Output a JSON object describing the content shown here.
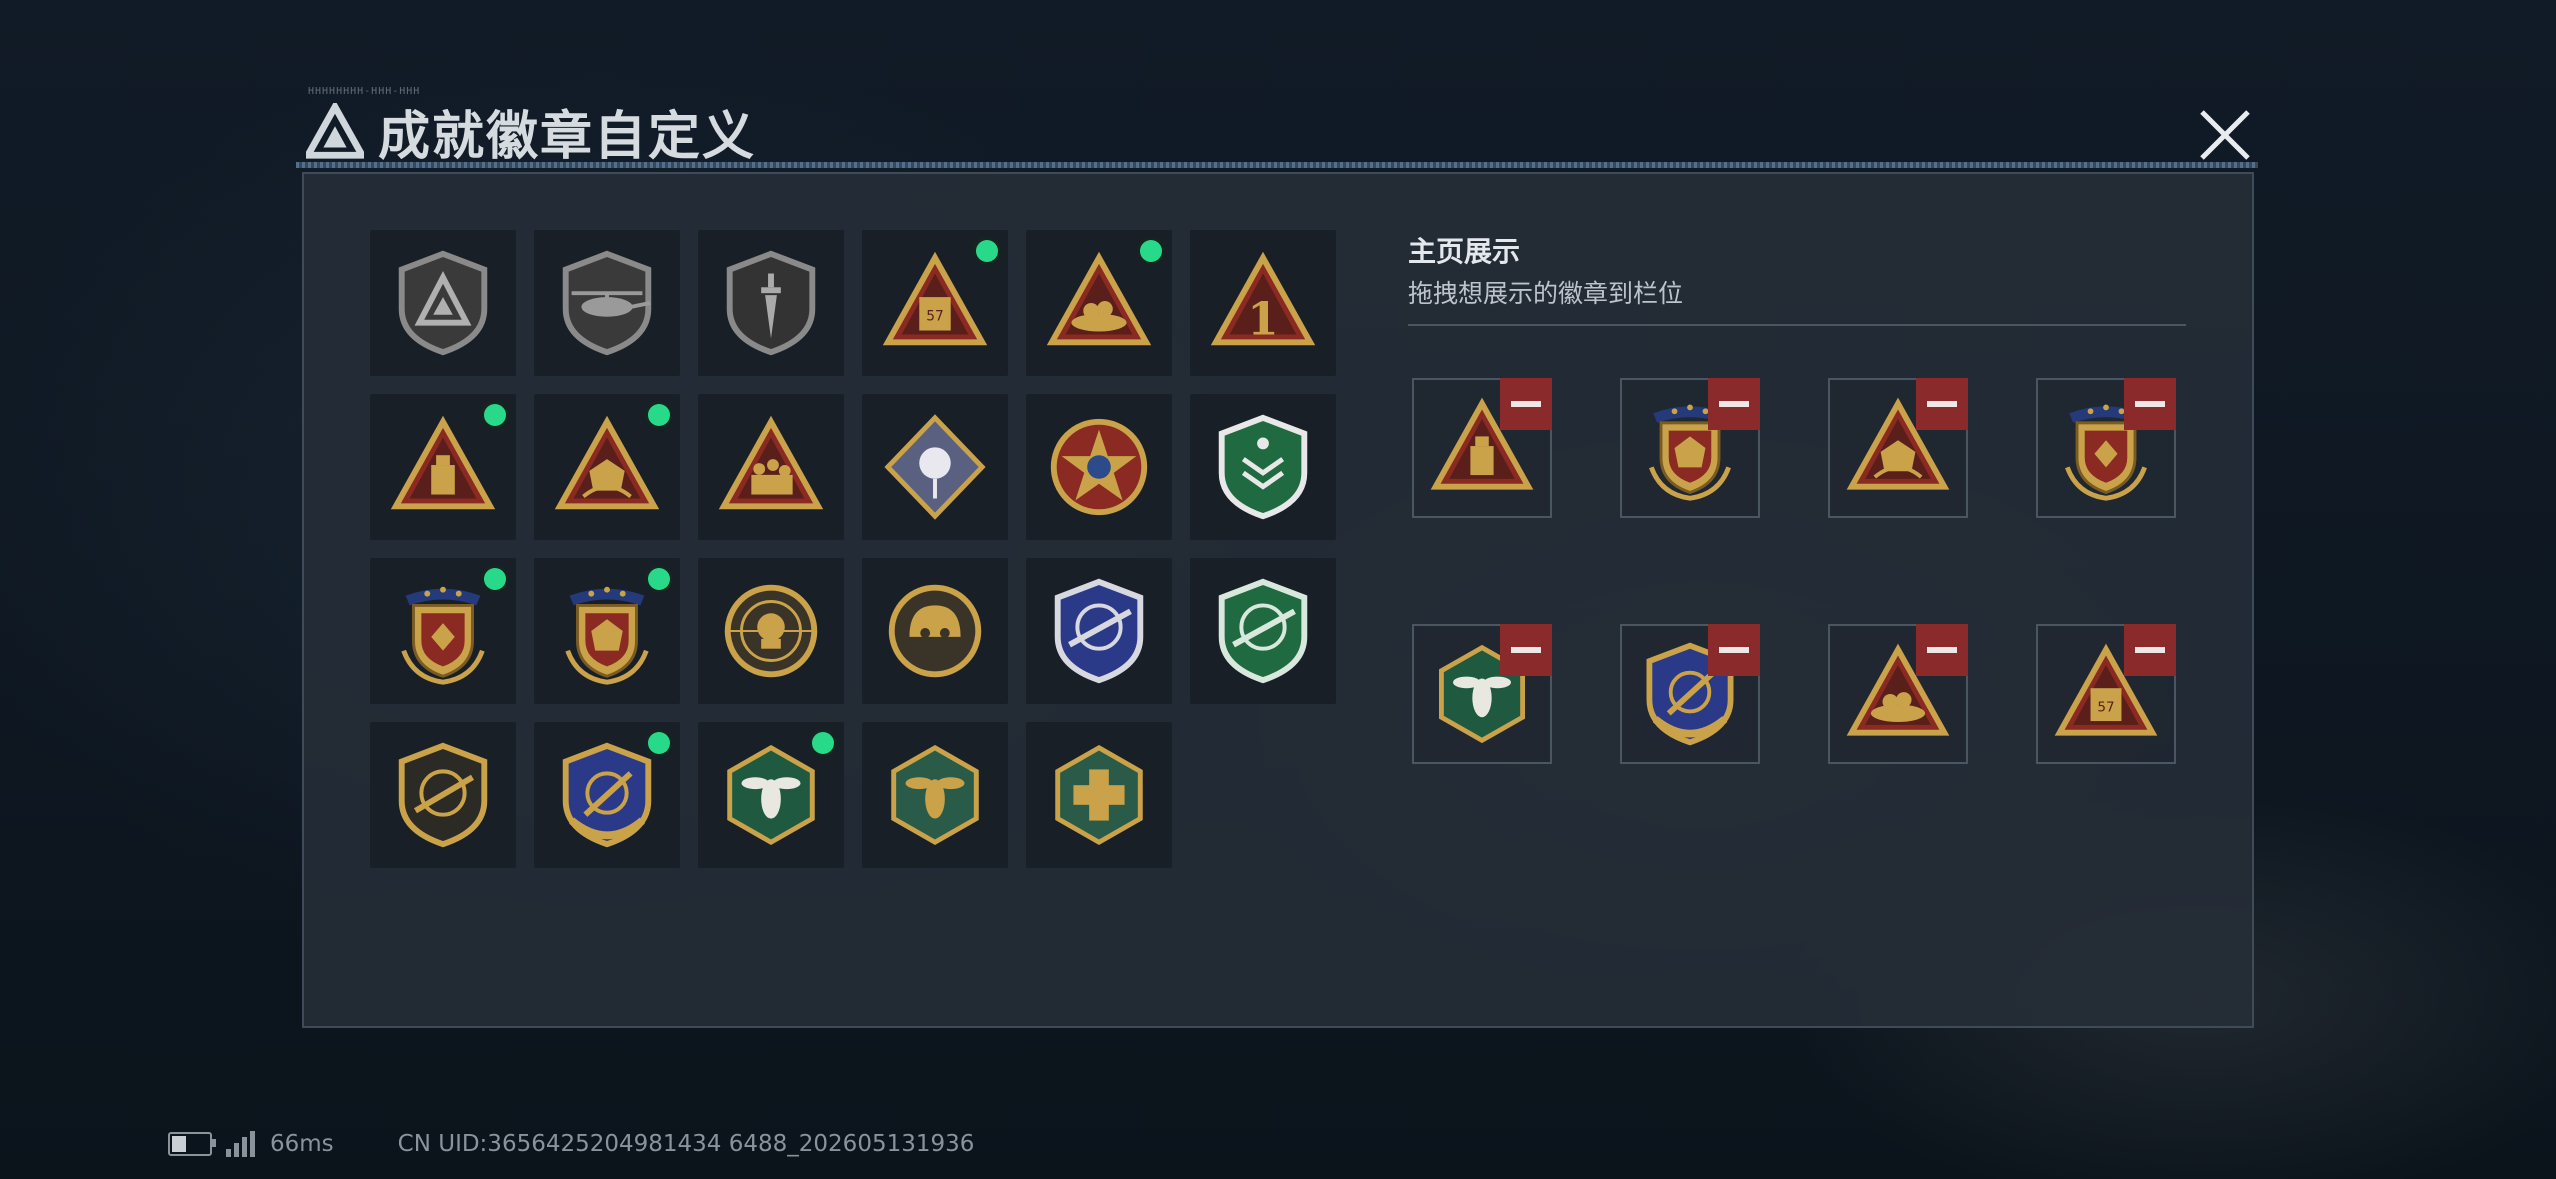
{
  "header": {
    "title": "成就徽章自定义",
    "micro_text": "HHHHHHHH-HHH-HHH"
  },
  "showcase": {
    "title": "主页展示",
    "subtitle": "拖拽想展示的徽章到栏位"
  },
  "status": {
    "ping": "66ms",
    "uid": "CN UID:3656425204981434 6488_202605131936"
  },
  "colors": {
    "accent_green": "#29d98a",
    "remove_red": "#8a2a2a",
    "gold": "#c9a24a",
    "panel": "#262e38"
  },
  "badges": [
    {
      "icon": "gray-triangle-logo-badge-icon",
      "new": false
    },
    {
      "icon": "helicopter-shield-badge-icon",
      "new": false
    },
    {
      "icon": "dagger-shield-badge-icon",
      "new": false
    },
    {
      "icon": "ammo-box-triangle-badge-icon",
      "new": true
    },
    {
      "icon": "bird-nest-triangle-badge-icon",
      "new": true
    },
    {
      "icon": "number-one-triangle-badge-icon",
      "new": false
    },
    {
      "icon": "usb-drive-triangle-badge-icon",
      "new": true
    },
    {
      "icon": "d20-dice-triangle-badge-icon",
      "new": true
    },
    {
      "icon": "soldiers-triangle-badge-icon",
      "new": false
    },
    {
      "icon": "rose-diamond-badge-icon",
      "new": false
    },
    {
      "icon": "star-round-badge-icon",
      "new": false
    },
    {
      "icon": "green-rank-shield-badge-icon",
      "new": false
    },
    {
      "icon": "medal-arrow-badge-icon",
      "new": true
    },
    {
      "icon": "medal-d20-badge-icon",
      "new": true
    },
    {
      "icon": "skull-crosshair-badge-icon",
      "new": false
    },
    {
      "icon": "helmet-round-badge-icon",
      "new": false
    },
    {
      "icon": "blue-rifle-crosshair-badge-icon",
      "new": false
    },
    {
      "icon": "green-rifle-crosshair-badge-icon",
      "new": false
    },
    {
      "icon": "rifle-shield-badge-icon",
      "new": false
    },
    {
      "icon": "gold-shield-crosshair-badge-icon",
      "new": true
    },
    {
      "icon": "wasp-hexagon-badge-icon",
      "new": true
    },
    {
      "icon": "wasp-hexagon-gold-badge-icon",
      "new": false
    },
    {
      "icon": "medic-hexagon-badge-icon",
      "new": false
    }
  ],
  "slots": [
    {
      "icon": "usb-drive-triangle-badge-icon"
    },
    {
      "icon": "medal-d20-badge-icon"
    },
    {
      "icon": "d20-dice-triangle-badge-icon"
    },
    {
      "icon": "medal-arrow-badge-icon"
    },
    {
      "icon": "wasp-hexagon-badge-icon"
    },
    {
      "icon": "gold-shield-crosshair-badge-icon"
    },
    {
      "icon": "bird-nest-triangle-badge-icon"
    },
    {
      "icon": "ammo-box-triangle-badge-icon"
    }
  ]
}
